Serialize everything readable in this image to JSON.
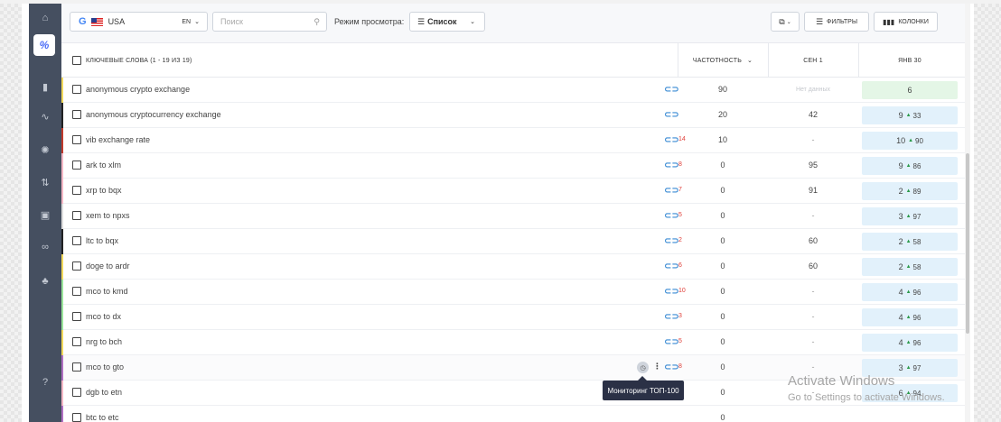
{
  "toolbar": {
    "google_logo": "G",
    "country": "USA",
    "lang": "EN",
    "search_placeholder": "Поиск",
    "view_mode_label": "Режим просмотра:",
    "view_mode_value": "Список",
    "filters_label": "ФИЛЬТРЫ",
    "columns_label": "КОЛОНКИ"
  },
  "table": {
    "headers": {
      "keywords": "КЛЮЧЕВЫЕ СЛОВА (1 - 19 ИЗ 19)",
      "frequency": "ЧАСТОТНОСТЬ",
      "sep1": "СЕН 1",
      "jan30": "ЯНВ 30"
    },
    "rows": [
      {
        "keyword": "anonymous crypto exchange",
        "link_count": "",
        "freq": "90",
        "sep": "Нет данных",
        "jan": "6",
        "jan_delta": "",
        "bar": "#f2d95c",
        "jan_green": true
      },
      {
        "keyword": "anonymous cryptocurrency exchange",
        "link_count": "",
        "freq": "20",
        "sep": "42",
        "jan": "9",
        "jan_delta": "33",
        "bar": "#222222",
        "jan_green": false
      },
      {
        "keyword": "vib exchange rate",
        "link_count": "14",
        "freq": "10",
        "sep": "-",
        "jan": "10",
        "jan_delta": "90",
        "bar": "#c0392b",
        "jan_green": false
      },
      {
        "keyword": "ark to xlm",
        "link_count": "8",
        "freq": "0",
        "sep": "95",
        "jan": "9",
        "jan_delta": "86",
        "bar": "#f5b7c5",
        "jan_green": false
      },
      {
        "keyword": "xrp to bqx",
        "link_count": "7",
        "freq": "0",
        "sep": "91",
        "jan": "2",
        "jan_delta": "89",
        "bar": "#f5b7c5",
        "jan_green": false
      },
      {
        "keyword": "xem to npxs",
        "link_count": "5",
        "freq": "0",
        "sep": "-",
        "jan": "3",
        "jan_delta": "97",
        "bar": "#dddddd",
        "jan_green": false
      },
      {
        "keyword": "ltc to bqx",
        "link_count": "2",
        "freq": "0",
        "sep": "60",
        "jan": "2",
        "jan_delta": "58",
        "bar": "#222222",
        "jan_green": false
      },
      {
        "keyword": "doge to ardr",
        "link_count": "6",
        "freq": "0",
        "sep": "60",
        "jan": "2",
        "jan_delta": "58",
        "bar": "#f2d95c",
        "jan_green": false
      },
      {
        "keyword": "mco to kmd",
        "link_count": "10",
        "freq": "0",
        "sep": "-",
        "jan": "4",
        "jan_delta": "96",
        "bar": "#9be59b",
        "jan_green": false
      },
      {
        "keyword": "mco to dx",
        "link_count": "3",
        "freq": "0",
        "sep": "-",
        "jan": "4",
        "jan_delta": "96",
        "bar": "#9be59b",
        "jan_green": false
      },
      {
        "keyword": "nrg to bch",
        "link_count": "5",
        "freq": "0",
        "sep": "-",
        "jan": "4",
        "jan_delta": "96",
        "bar": "#f2d95c",
        "jan_green": false
      },
      {
        "keyword": "mco to gto",
        "link_count": "8",
        "freq": "0",
        "sep": "-",
        "jan": "3",
        "jan_delta": "97",
        "bar": "#b06fc2",
        "jan_green": false
      },
      {
        "keyword": "dgb to etn",
        "link_count": "",
        "freq": "0",
        "sep": "-",
        "jan": "6",
        "jan_delta": "94",
        "bar": "#f5b7c5",
        "jan_green": false
      },
      {
        "keyword": "btc to etc",
        "link_count": "",
        "freq": "0",
        "sep": "",
        "jan": "",
        "jan_delta": "",
        "bar": "#b06fc2",
        "jan_green": false
      }
    ]
  },
  "tooltip": "Мониторинг ТОП-100",
  "watermark": {
    "line1": "Activate Windows",
    "line2": "Go to Settings to activate Windows."
  }
}
